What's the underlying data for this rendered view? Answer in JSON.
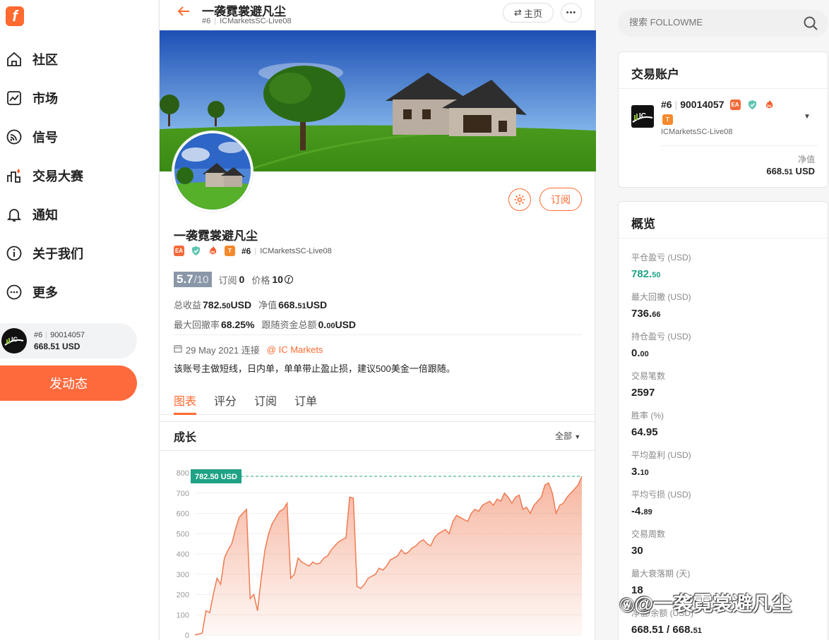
{
  "nav": {
    "logo": "f",
    "items": [
      {
        "label": "社区",
        "icon": "home-icon"
      },
      {
        "label": "市场",
        "icon": "chart-line-icon"
      },
      {
        "label": "信号",
        "icon": "signal-icon"
      },
      {
        "label": "交易大赛",
        "icon": "contest-icon"
      },
      {
        "label": "通知",
        "icon": "bell-icon"
      },
      {
        "label": "关于我们",
        "icon": "info-icon"
      },
      {
        "label": "更多",
        "icon": "more-icon"
      }
    ],
    "account": {
      "rank_id": "#6",
      "number": "90014057",
      "equity": "668.51 USD"
    },
    "post_button": "发动态"
  },
  "header": {
    "title": "一袭霓裳避凡尘",
    "rank": "#6",
    "server": "ICMarketsSC-Live08",
    "home_button": "主页",
    "more": "•••"
  },
  "profile": {
    "name": "一袭霓裳避凡尘",
    "badge_ea": "EA",
    "badge_t": "T",
    "badge_pk": "PK",
    "rank": "#6",
    "server": "ICMarketsSC-Live08",
    "subscribe_button": "订阅",
    "score": "5.7",
    "score_max": "/10",
    "subs_label": "订阅",
    "subs_value": "0",
    "price_label": "价格",
    "price_value": "10",
    "profit_label": "总收益",
    "profit_int": "782.",
    "profit_dec": "50",
    "profit_unit": " USD",
    "equity_label": "净值",
    "equity_int": "668.",
    "equity_dec": "51",
    "equity_unit": " USD",
    "drawdown_label": "最大回撤率",
    "drawdown_value": "68.25%",
    "follow_label": "跟随资金总额",
    "follow_int": "0.",
    "follow_dec": "00",
    "follow_unit": " USD",
    "date": "29 May 2021 连接",
    "broker": "@ IC Markets",
    "description": "该账号主做短线，日内单，单单带止盈止损，建议500美金一倍跟随。"
  },
  "tabs": [
    "图表",
    "评分",
    "订阅",
    "订单"
  ],
  "growth": {
    "title": "成长",
    "filter": "全部"
  },
  "chart_data": {
    "type": "area",
    "title": "成长",
    "ylim": [
      0,
      800
    ],
    "y_ticks": [
      "800",
      "700",
      "600",
      "500",
      "400",
      "300",
      "200",
      "100",
      "0"
    ],
    "marker_label": "782.50 USD",
    "marker_value": 782.5,
    "color": "#f07a52",
    "values": [
      0,
      5,
      10,
      120,
      110,
      200,
      280,
      250,
      380,
      420,
      450,
      520,
      580,
      600,
      620,
      180,
      200,
      120,
      280,
      420,
      500,
      550,
      580,
      610,
      620,
      650,
      280,
      300,
      380,
      360,
      350,
      340,
      360,
      350,
      355,
      380,
      390,
      420,
      440,
      460,
      470,
      480,
      680,
      675,
      240,
      230,
      250,
      280,
      290,
      300,
      330,
      320,
      340,
      370,
      380,
      390,
      420,
      400,
      410,
      430,
      440,
      460,
      470,
      450,
      440,
      480,
      500,
      510,
      520,
      500,
      560,
      590,
      580,
      570,
      560,
      600,
      620,
      610,
      640,
      650,
      660,
      640,
      670,
      660,
      700,
      680,
      650,
      680,
      690,
      620,
      630,
      600,
      640,
      660,
      680,
      740,
      750,
      700,
      600,
      640,
      650,
      680,
      700,
      720,
      740,
      782.5
    ]
  },
  "search": {
    "placeholder": "搜索 FOLLOWME"
  },
  "trade_account": {
    "title": "交易账户",
    "rank": "#6",
    "number": "90014057",
    "badge_ea": "EA",
    "badge_t": "T",
    "badge_pk": "PK",
    "server": "ICMarketsSC-Live08",
    "equity_label": "净值",
    "equity_int": "668.",
    "equity_dec": "51",
    "equity_unit": " USD"
  },
  "overview": {
    "title": "概览",
    "stats": [
      {
        "label": "平仓盈亏 (USD)",
        "int": "782.",
        "dec": "50",
        "color": "#1fa285"
      },
      {
        "label": "最大回撤 (USD)",
        "int": "736.",
        "dec": "66",
        "color": "#222222"
      },
      {
        "label": "持仓盈亏 (USD)",
        "int": "0.",
        "dec": "00",
        "color": "#222222"
      },
      {
        "label": "交易笔数",
        "int": "2597",
        "dec": "",
        "color": "#222222"
      },
      {
        "label": "胜率 (%)",
        "int": "64.95",
        "dec": "",
        "color": "#222222"
      },
      {
        "label": "平均盈利 (USD)",
        "int": "3.",
        "dec": "10",
        "color": "#222222"
      },
      {
        "label": "平均亏损 (USD)",
        "int": "-4.",
        "dec": "89",
        "color": "#222222"
      },
      {
        "label": "交易周数",
        "int": "30",
        "dec": "",
        "color": "#222222"
      },
      {
        "label": "最大衰落期 (天)",
        "int": "18",
        "dec": "",
        "color": "#222222"
      },
      {
        "label": "净值/余额 (USD)",
        "int": "668.51 / 668.",
        "dec": "51",
        "color": "#222222"
      }
    ]
  },
  "watermark": "@一袭霓裳避凡尘"
}
